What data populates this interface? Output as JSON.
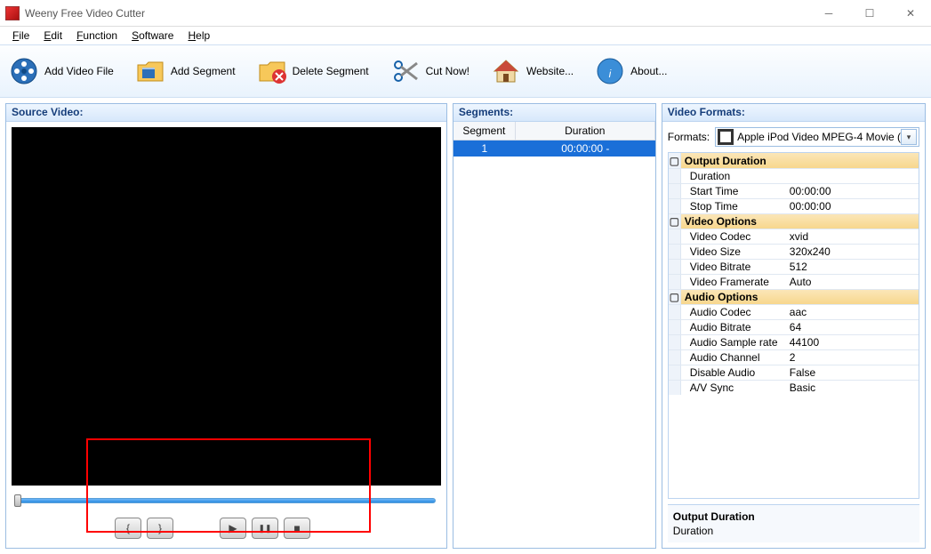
{
  "window": {
    "title": "Weeny Free Video Cutter"
  },
  "menu": {
    "file": "File",
    "edit": "Edit",
    "function": "Function",
    "software": "Software",
    "help": "Help"
  },
  "toolbar": {
    "add_video": "Add Video File",
    "add_segment": "Add Segment",
    "delete_segment": "Delete Segment",
    "cut_now": "Cut Now!",
    "website": "Website...",
    "about": "About..."
  },
  "panels": {
    "source": "Source Video:",
    "segments": "Segments:",
    "formats": "Video Formats:"
  },
  "segments": {
    "col_segment": "Segment",
    "col_duration": "Duration",
    "rows": [
      {
        "id": "1",
        "duration": "00:00:00 -"
      }
    ]
  },
  "formats": {
    "label": "Formats:",
    "selected": "Apple iPod Video MPEG-4 Movie (",
    "sections": [
      {
        "name": "Output Duration",
        "items": [
          {
            "k": "Duration",
            "v": ""
          },
          {
            "k": "Start Time",
            "v": "00:00:00"
          },
          {
            "k": "Stop Time",
            "v": "00:00:00"
          }
        ]
      },
      {
        "name": "Video Options",
        "items": [
          {
            "k": "Video Codec",
            "v": "xvid"
          },
          {
            "k": "Video Size",
            "v": "320x240"
          },
          {
            "k": "Video Bitrate",
            "v": "512"
          },
          {
            "k": "Video Framerate",
            "v": "Auto"
          }
        ]
      },
      {
        "name": "Audio Options",
        "items": [
          {
            "k": "Audio Codec",
            "v": "aac"
          },
          {
            "k": "Audio Bitrate",
            "v": "64"
          },
          {
            "k": "Audio Sample rate",
            "v": "44100"
          },
          {
            "k": "Audio Channel",
            "v": "2"
          },
          {
            "k": "Disable Audio",
            "v": "False"
          },
          {
            "k": "A/V Sync",
            "v": "Basic"
          }
        ]
      }
    ],
    "detail": {
      "title": "Output Duration",
      "desc": "Duration"
    }
  },
  "player": {
    "mark_in": "{",
    "mark_out": "}",
    "play": "▶",
    "pause": "❚❚",
    "stop": "■"
  }
}
